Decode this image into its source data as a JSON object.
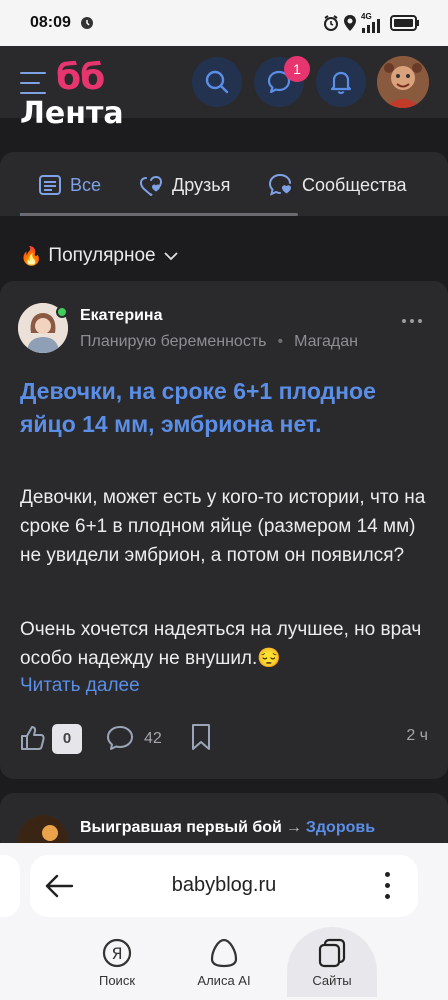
{
  "status_bar": {
    "time": "08:09",
    "network": "4G"
  },
  "header": {
    "logo": "бб",
    "notification_badge": "1",
    "accent_color": "#e7356f",
    "link_color": "#5b8ee6"
  },
  "feed": {
    "title": "Лента"
  },
  "tabs": [
    {
      "label": "Все",
      "active": true
    },
    {
      "label": "Друзья",
      "active": false
    },
    {
      "label": "Сообщества",
      "active": false
    }
  ],
  "filter": {
    "label": "Популярное"
  },
  "post": {
    "author": "Екатерина",
    "status": "Планирую беременность",
    "location": "Магадан",
    "title": "Девочки, на сроке 6+1 плодное яйцо 14 мм, эмбриона нет.",
    "body1": "Девочки, может есть у кого-то истории, что на сроке 6+1 в плодном яйце (размером 14 мм) не увидели эмбрион, а потом он появился?",
    "body2": "Очень хочется надеяться на лучшее, но врач особо надежду не внушил.😔",
    "read_more": "Читать далее",
    "likes": "0",
    "comments": "42",
    "time": "2 ч"
  },
  "next_post": {
    "author": "Выигравшая первый бой",
    "arrow": "→",
    "category": "Здоровь"
  },
  "browser": {
    "url": "babyblog.ru",
    "nav": [
      {
        "label": "Поиск"
      },
      {
        "label": "Алиса AI"
      },
      {
        "label": "Сайты"
      }
    ]
  }
}
